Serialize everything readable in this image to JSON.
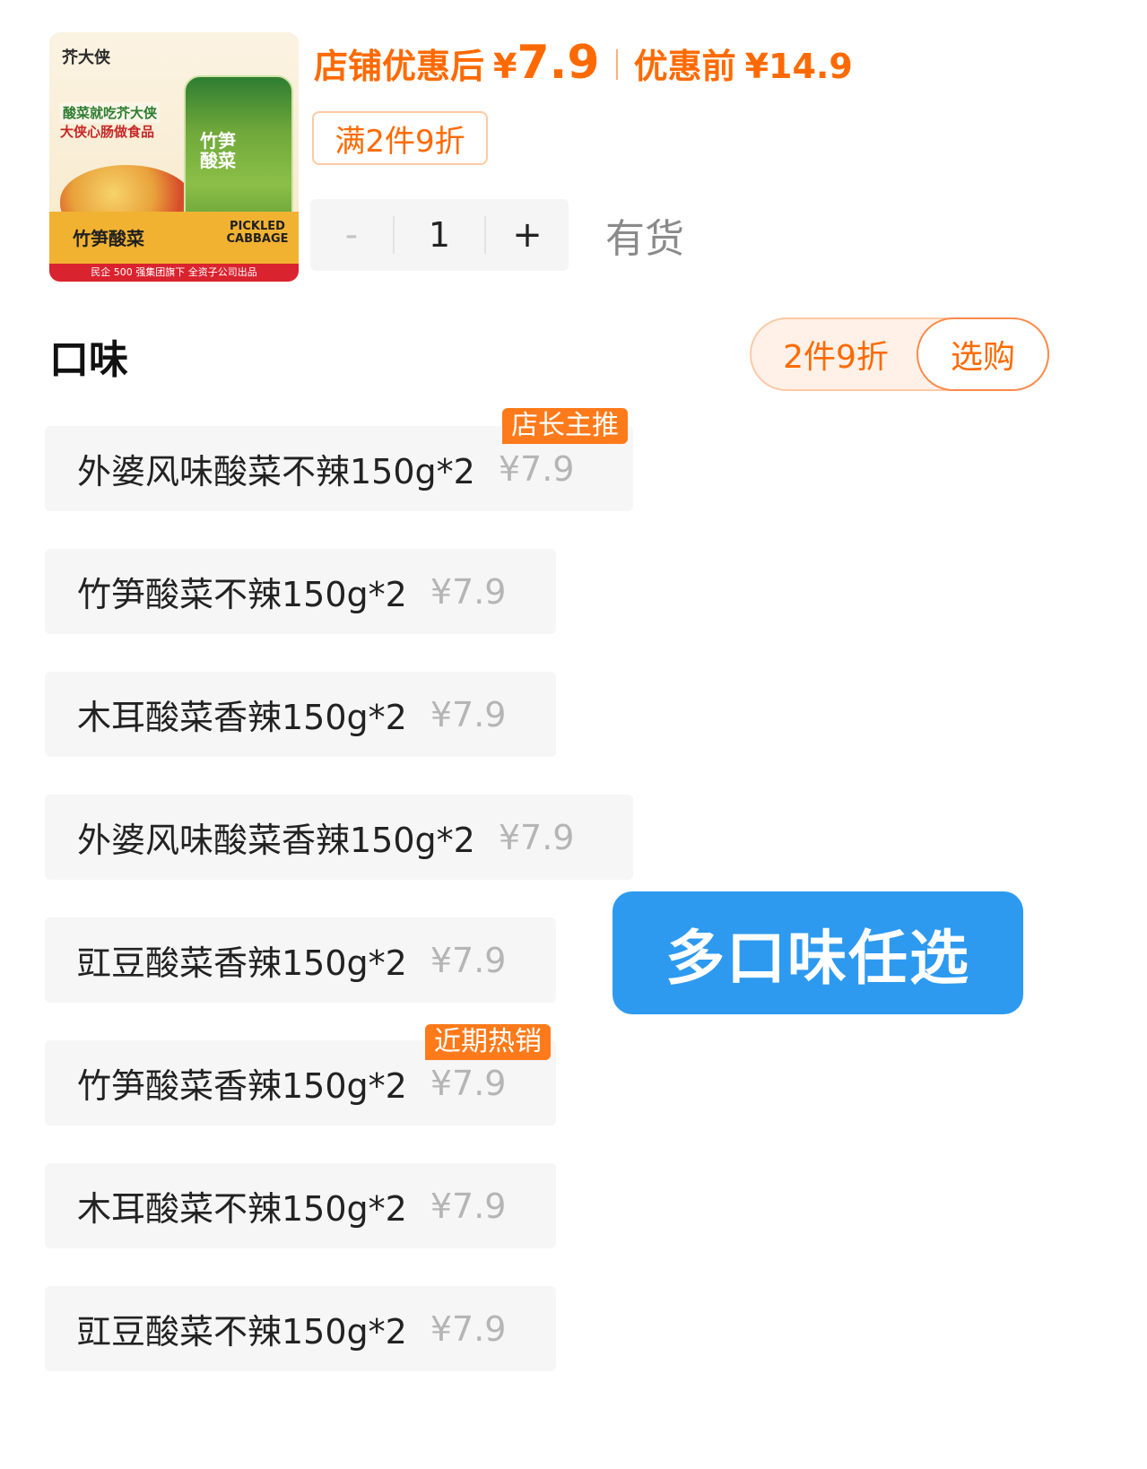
{
  "product": {
    "brand": "芥大侠",
    "slogan1": "酸菜就吃芥大侠",
    "slogan2": "大侠心肠做食品",
    "jar_label": "竹笋酸菜",
    "bottom_cn": "竹笋酸菜",
    "bottom_en": "PICKLED CABBAGE",
    "footer": "民企 500 强集团旗下 全资子公司出品"
  },
  "price": {
    "after_label": "店铺优惠后",
    "currency": "¥",
    "after_value": "7.9",
    "before_label": "优惠前",
    "before_value": "¥14.9"
  },
  "promo_tag": "满2件9折",
  "stepper": {
    "minus": "-",
    "qty": "1",
    "plus": "+"
  },
  "stock": "有货",
  "section_title": "口味",
  "deal": {
    "text": "2件9折",
    "button": "选购"
  },
  "options": [
    {
      "name": "外婆风味酸菜不辣150g*2",
      "price": "¥7.9",
      "badge": "店长主推"
    },
    {
      "name": "竹笋酸菜不辣150g*2",
      "price": "¥7.9",
      "badge": ""
    },
    {
      "name": "木耳酸菜香辣150g*2",
      "price": "¥7.9",
      "badge": ""
    },
    {
      "name": "外婆风味酸菜香辣150g*2",
      "price": "¥7.9",
      "badge": ""
    },
    {
      "name": "豇豆酸菜香辣150g*2",
      "price": "¥7.9",
      "badge": ""
    },
    {
      "name": "竹笋酸菜香辣150g*2",
      "price": "¥7.9",
      "badge": "近期热销"
    },
    {
      "name": "木耳酸菜不辣150g*2",
      "price": "¥7.9",
      "badge": ""
    },
    {
      "name": "豇豆酸菜不辣150g*2",
      "price": "¥7.9",
      "badge": ""
    }
  ],
  "overlay": "多口味任选",
  "colors": {
    "accent": "#ff6a00",
    "badge": "#ff7a1a",
    "overlay": "#2d9af0"
  }
}
